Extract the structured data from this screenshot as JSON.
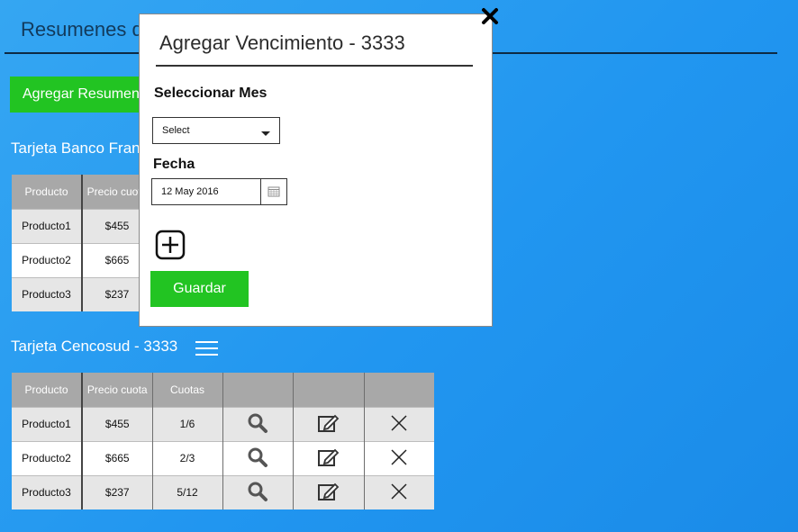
{
  "page": {
    "title": "Resumenes d",
    "add_summary_label": "Agregar Resumen"
  },
  "sections": [
    {
      "title": "Tarjeta Banco Fran",
      "headers": [
        "Producto",
        "Precio cuota"
      ],
      "rows": [
        [
          "Producto1",
          "$455"
        ],
        [
          "Producto2",
          "$665"
        ],
        [
          "Producto3",
          "$237"
        ]
      ]
    },
    {
      "title": "Tarjeta Cencosud - 3333",
      "headers": [
        "Producto",
        "Precio cuota",
        "Cuotas",
        "",
        "",
        ""
      ],
      "rows": [
        [
          "Producto1",
          "$455",
          "1/6"
        ],
        [
          "Producto2",
          "$665",
          "2/3"
        ],
        [
          "Producto3",
          "$237",
          "5/12"
        ]
      ],
      "row_icons": [
        "search-icon",
        "edit-icon",
        "delete-icon"
      ]
    }
  ],
  "modal": {
    "title": "Agregar Vencimiento - 3333",
    "month_label": "Seleccionar Mes",
    "month_select_value": "Select",
    "date_label": "Fecha",
    "date_value": "12 May 2016",
    "add_icon": "plus-square-icon",
    "save_label": "Guardar",
    "close_icon": "close-icon"
  },
  "colors": {
    "background": "#2196f0",
    "green_button": "#22c422",
    "table_header": "#a8a8a8",
    "table_cell": "#e6e6e6"
  }
}
